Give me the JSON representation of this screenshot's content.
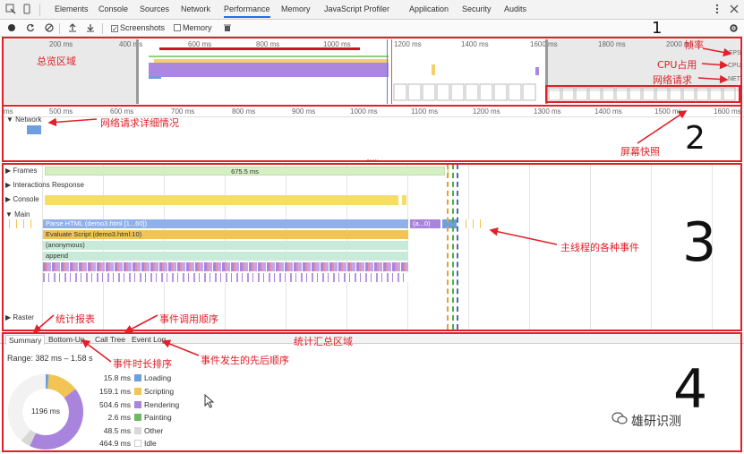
{
  "tabs": [
    "Elements",
    "Console",
    "Sources",
    "Network",
    "Performance",
    "Memory",
    "JavaScript Profiler",
    "Application",
    "Security",
    "Audits"
  ],
  "active_tab": "Performance",
  "toolbar": {
    "screenshots_label": "Screenshots",
    "memory_label": "Memory"
  },
  "overview": {
    "ruler": [
      "200 ms",
      "400 ms",
      "600 ms",
      "800 ms",
      "1000 ms",
      "1200 ms",
      "1400 ms",
      "1600 ms",
      "1800 ms",
      "2000 ms"
    ],
    "fps_label": "FPS",
    "cpu_label": "CPU",
    "net_label": "NET"
  },
  "detail_ruler": [
    "ms",
    "500 ms",
    "600 ms",
    "700 ms",
    "800 ms",
    "900 ms",
    "1000 ms",
    "1100 ms",
    "1200 ms",
    "1300 ms",
    "1400 ms",
    "1500 ms",
    "1600 ms"
  ],
  "network_track": "Network",
  "tracks": {
    "frames": "Frames",
    "frames_value": "675.5 ms",
    "interactions": "Interactions Response",
    "console": "Console",
    "main": "Main",
    "raster": "Raster"
  },
  "flame": {
    "parse_html": "Parse HTML (demo3.html [1...60])",
    "parse_tail": "(a...0)",
    "evaluate": "Evaluate Script (demo3.html:10)",
    "anonymous": "(anonymous)",
    "append": "append"
  },
  "summary_tabs": [
    "Summary",
    "Bottom-Up",
    "Call Tree",
    "Event Log"
  ],
  "summary": {
    "range": "Range: 382 ms – 1.58 s",
    "total": "1196 ms",
    "legend": [
      {
        "value": "15.8 ms",
        "label": "Loading",
        "color": "#6f9ee0"
      },
      {
        "value": "159.1 ms",
        "label": "Scripting",
        "color": "#f1c453"
      },
      {
        "value": "504.6 ms",
        "label": "Rendering",
        "color": "#a984dd"
      },
      {
        "value": "2.6 ms",
        "label": "Painting",
        "color": "#71b866"
      },
      {
        "value": "48.5 ms",
        "label": "Other",
        "color": "#d8d8d8"
      },
      {
        "value": "464.9 ms",
        "label": "Idle",
        "color": "#ffffff"
      }
    ]
  },
  "annotations": {
    "overview_area": "总览区域",
    "frame_rate": "帧率",
    "cpu_usage": "CPU占用",
    "network_requests": "网络请求",
    "network_detail": "网络请求详细情况",
    "screenshots": "屏幕快照",
    "main_events": "主线程的各种事件",
    "stats_report": "统计报表",
    "call_order": "事件调用顺序",
    "summary_area": "统计汇总区域",
    "duration_sort": "事件时长排序",
    "event_sequence": "事件发生的先后顺序",
    "watermark": "雄研识测",
    "num1": "1",
    "num2": "2",
    "num3": "3",
    "num4": "4"
  },
  "colors": {
    "annotation": "#e0202a",
    "loading": "#6f9ee0",
    "scripting": "#f1c453",
    "rendering": "#a984dd",
    "painting": "#71b866",
    "other": "#d8d8d8",
    "idle": "#ffffff"
  }
}
